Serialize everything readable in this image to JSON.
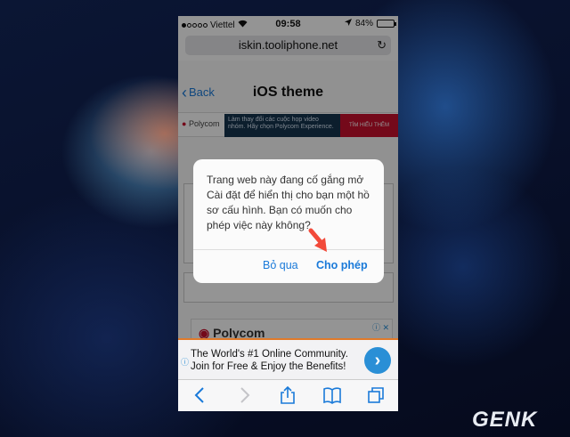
{
  "status_bar": {
    "carrier": "Viettel",
    "time": "09:58",
    "battery_text": "84%",
    "battery_level": 0.84
  },
  "browser": {
    "url": "iskin.tooliphone.net"
  },
  "page": {
    "back_label": "Back",
    "title": "iOS theme",
    "top_ad": {
      "logo": "Polycom",
      "banner_text": "Làm thay đổi các cuộc họp video nhóm. Hãy chọn Polycom Experience.",
      "cta": "TÌM HIỂU THÊM"
    },
    "bottom_ad_logo": "Polycom"
  },
  "dialog": {
    "message": "Trang web này đang cố gắng mở Cài đặt để hiển thị cho bạn một hồ sơ cấu hình. Bạn có muốn cho phép việc này không?",
    "cancel_label": "Bỏ qua",
    "allow_label": "Cho phép"
  },
  "footer_ad": {
    "text": "The World's #1 Online Community. Join for Free & Enjoy the Benefits!"
  },
  "watermark": "GENK",
  "colors": {
    "accent": "#1a7ad9",
    "arrow": "#f24a3a",
    "ad_orange": "#e07a2a"
  }
}
